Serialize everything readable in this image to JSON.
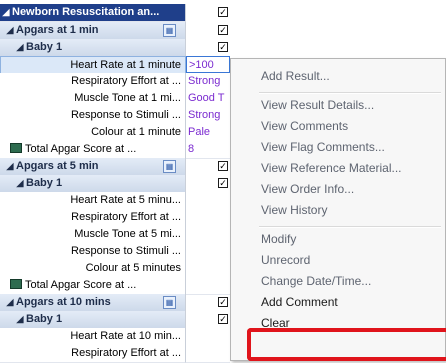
{
  "grid": {
    "root": {
      "label": "Newborn Resuscitation an...",
      "checked": true
    },
    "rows": [
      {
        "kind": "hdr",
        "label": "Apgars at 1 min",
        "indent": 1,
        "group_icon": true,
        "checked": true
      },
      {
        "kind": "hdr",
        "label": "Baby 1",
        "indent": 2,
        "checked": true
      },
      {
        "kind": "item",
        "label": "Heart Rate at 1 minute",
        "value": ">100",
        "selected": true
      },
      {
        "kind": "item",
        "label": "Respiratory Effort at ...",
        "value": "Strong"
      },
      {
        "kind": "item",
        "label": "Muscle Tone at 1 mi...",
        "value": "Good T"
      },
      {
        "kind": "item",
        "label": "Response to Stimuli ...",
        "value": "Strong"
      },
      {
        "kind": "item",
        "label": "Colour at 1 minute",
        "value": "Pale"
      },
      {
        "kind": "total",
        "label": "Total Apgar Score at ...",
        "value": "8"
      },
      {
        "kind": "hdr",
        "label": "Apgars at 5 min",
        "indent": 1,
        "group_icon": true,
        "checked": true
      },
      {
        "kind": "hdr",
        "label": "Baby 1",
        "indent": 2,
        "checked": true
      },
      {
        "kind": "item",
        "label": "Heart Rate at 5 minu...",
        "value": ""
      },
      {
        "kind": "item",
        "label": "Respiratory Effort at ...",
        "value": ""
      },
      {
        "kind": "item",
        "label": "Muscle Tone at 5 mi...",
        "value": ""
      },
      {
        "kind": "item",
        "label": "Response to Stimuli ...",
        "value": ""
      },
      {
        "kind": "item",
        "label": "Colour at 5 minutes",
        "value": ""
      },
      {
        "kind": "total",
        "label": "Total Apgar Score at ...",
        "value": ""
      },
      {
        "kind": "hdr",
        "label": "Apgars at 10 mins",
        "indent": 1,
        "group_icon": true,
        "checked": true
      },
      {
        "kind": "hdr",
        "label": "Baby 1",
        "indent": 2,
        "checked": true
      },
      {
        "kind": "item",
        "label": "Heart Rate at 10 min...",
        "value": ""
      },
      {
        "kind": "item",
        "label": "Respiratory Effort at ...",
        "value": ""
      }
    ]
  },
  "context_menu": {
    "items": [
      {
        "label": "Add Result...",
        "enabled": false
      },
      {
        "sep": true
      },
      {
        "label": "View Result Details...",
        "enabled": false
      },
      {
        "label": "View Comments",
        "enabled": false
      },
      {
        "label": "View Flag Comments...",
        "enabled": false
      },
      {
        "label": "View Reference Material...",
        "enabled": false
      },
      {
        "label": "View Order Info...",
        "enabled": false
      },
      {
        "label": "View History",
        "enabled": false
      },
      {
        "sep": true
      },
      {
        "label": "Modify",
        "enabled": false
      },
      {
        "label": "Unrecord",
        "enabled": false
      },
      {
        "label": "Change Date/Time...",
        "enabled": false
      },
      {
        "label": "Add Comment",
        "enabled": true
      },
      {
        "label": "Clear",
        "enabled": true,
        "highlighted": true
      }
    ]
  },
  "colors": {
    "highlight": "#e0141b",
    "value_text": "#7b2bd0",
    "root_bg": "#1f3f8a"
  }
}
